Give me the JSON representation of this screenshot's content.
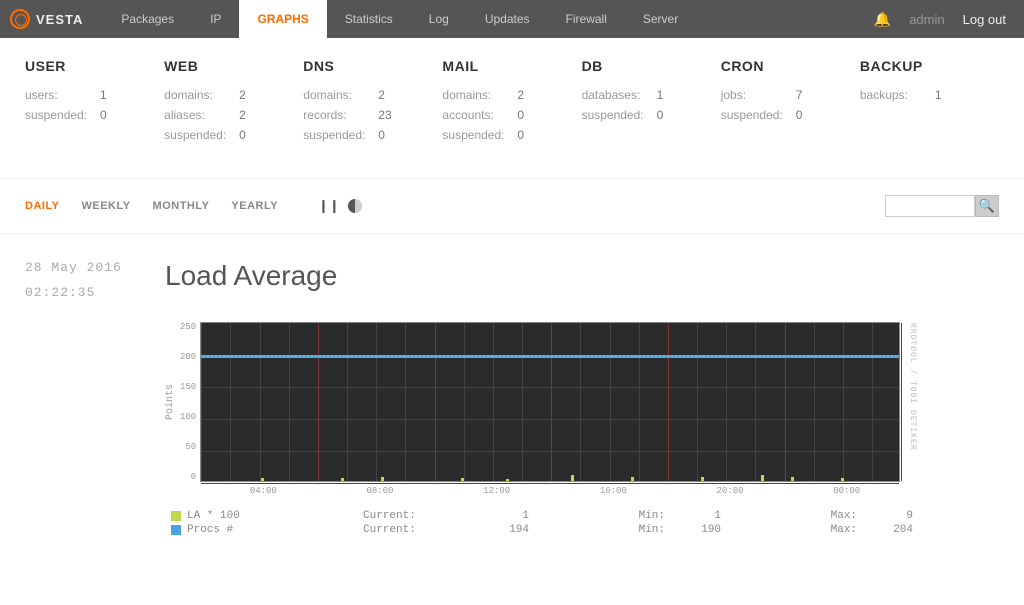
{
  "brand": "VESTA",
  "nav": {
    "items": [
      "Packages",
      "IP",
      "GRAPHS",
      "Statistics",
      "Log",
      "Updates",
      "Firewall",
      "Server"
    ],
    "active": "GRAPHS",
    "user": "admin",
    "logout": "Log out"
  },
  "stats": [
    {
      "title": "USER",
      "lines": [
        [
          "users:",
          "1"
        ],
        [
          "suspended:",
          "0"
        ]
      ]
    },
    {
      "title": "WEB",
      "lines": [
        [
          "domains:",
          "2"
        ],
        [
          "aliases:",
          "2"
        ],
        [
          "suspended:",
          "0"
        ]
      ]
    },
    {
      "title": "DNS",
      "lines": [
        [
          "domains:",
          "2"
        ],
        [
          "records:",
          "23"
        ],
        [
          "suspended:",
          "0"
        ]
      ]
    },
    {
      "title": "MAIL",
      "lines": [
        [
          "domains:",
          "2"
        ],
        [
          "accounts:",
          "0"
        ],
        [
          "suspended:",
          "0"
        ]
      ]
    },
    {
      "title": "DB",
      "lines": [
        [
          "databases:",
          "1"
        ],
        [
          "suspended:",
          "0"
        ]
      ]
    },
    {
      "title": "CRON",
      "lines": [
        [
          "jobs:",
          "7"
        ],
        [
          "suspended:",
          "0"
        ]
      ]
    },
    {
      "title": "BACKUP",
      "lines": [
        [
          "backups:",
          "1"
        ]
      ]
    }
  ],
  "periods": {
    "items": [
      "DAILY",
      "WEEKLY",
      "MONTHLY",
      "YEARLY"
    ],
    "active": "DAILY"
  },
  "search": {
    "placeholder": ""
  },
  "timestamp": {
    "date": "28 May 2016",
    "time": "02:22:35"
  },
  "chart_title": "Load Average",
  "chart_data": {
    "type": "line",
    "title": "Load Average",
    "ylabel": "Points",
    "ylim": [
      0,
      250
    ],
    "yticks": [
      250,
      200,
      150,
      100,
      50,
      0
    ],
    "xticks": [
      "04:00",
      "08:00",
      "12:00",
      "16:00",
      "20:00",
      "00:00"
    ],
    "series": [
      {
        "name": "LA * 100",
        "color": "#bfd84c",
        "stats": {
          "Current": 1,
          "Min": 1,
          "Max": 9
        }
      },
      {
        "name": "Procs #",
        "color": "#4aa3df",
        "stats": {
          "Current": 194,
          "Min": 190,
          "Max": 204
        }
      }
    ],
    "watermark": "RRDTOOL / TOBI OETIKER"
  },
  "legend_labels": {
    "current": "Current:",
    "min": "Min:",
    "max": "Max:"
  }
}
